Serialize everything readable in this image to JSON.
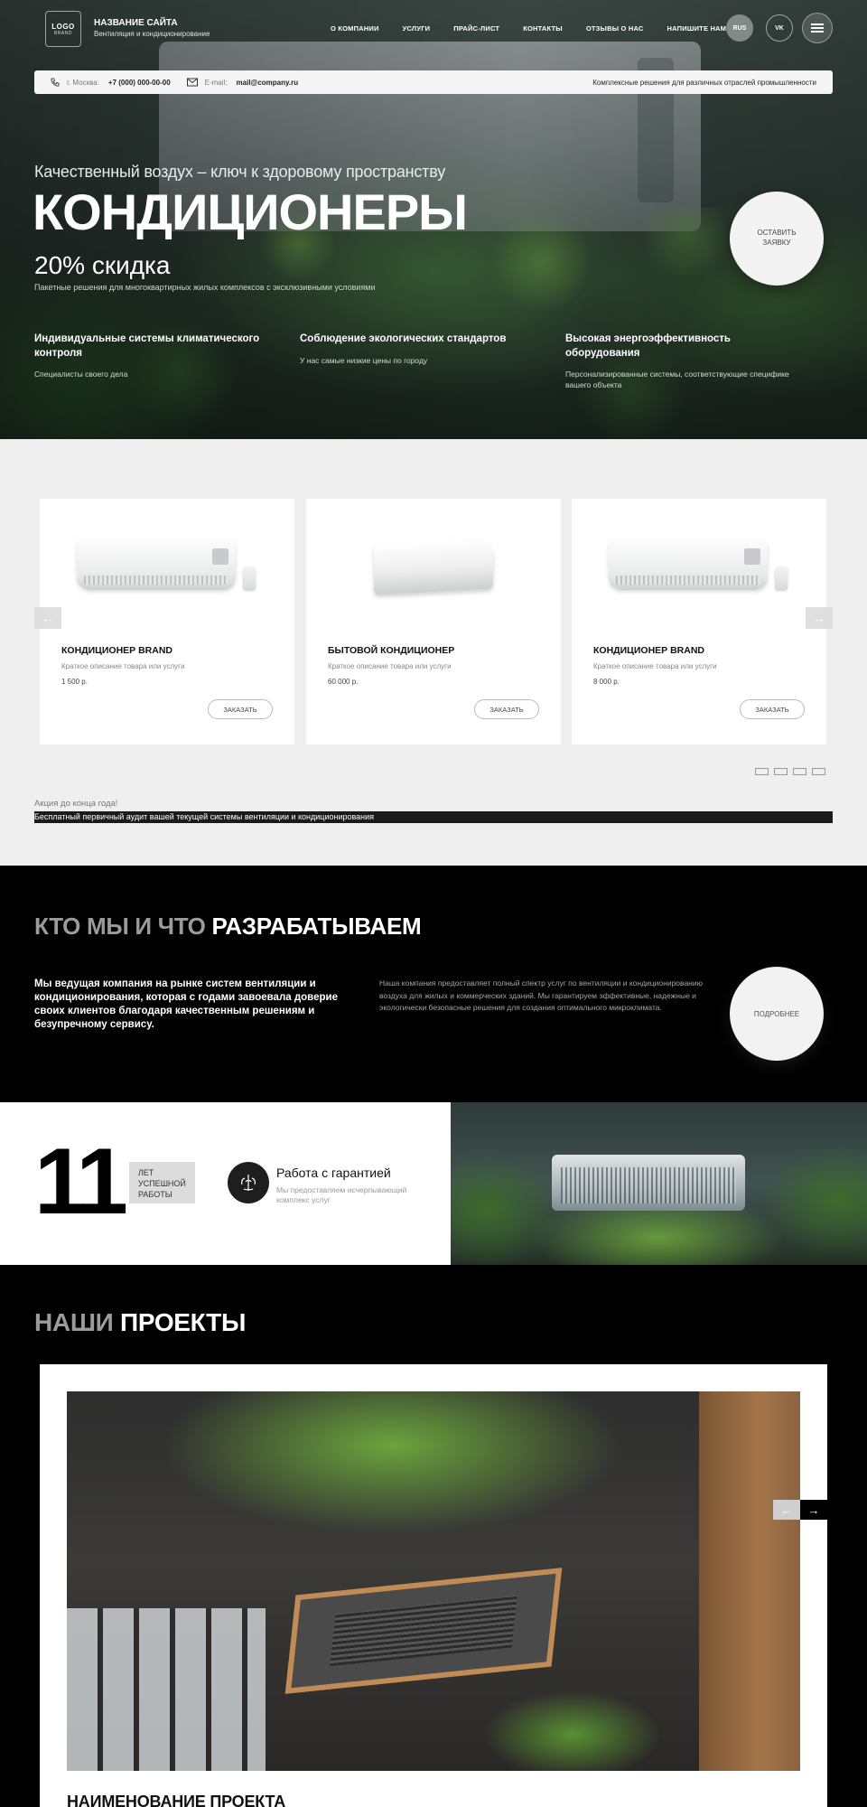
{
  "header": {
    "logo_line1": "LOGO",
    "logo_line2": "BRAND",
    "site_title": "НАЗВАНИЕ САЙТА",
    "site_subtitle": "Вентиляция и кондиционирование",
    "nav": [
      "О КОМПАНИИ",
      "УСЛУГИ",
      "ПРАЙС-ЛИСТ",
      "КОНТАКТЫ",
      "ОТЗЫВЫ О НАС",
      "НАПИШИТЕ НАМ"
    ],
    "lang_label": "RUS",
    "vk_label": "VK",
    "menu_icon": "hamburger-icon"
  },
  "info_bar": {
    "city_label": "г. Москва:",
    "phone": "+7 (000) 000-00-00",
    "email_label": "E-mail:",
    "email": "mail@company.ru",
    "tagline": "Комплексные решения для различных отраслей промышленности"
  },
  "hero": {
    "subtitle": "Качественный воздух – ключ к здоровому пространству",
    "title": "КОНДИЦИОНЕРЫ",
    "discount": "20% скидка",
    "discount_note": "Пакетные решения для многоквартирных жилых комплексов с эксклюзивными условиями",
    "cta_line1": "ОСТАВИТЬ",
    "cta_line2": "ЗАЯВКУ",
    "features": [
      {
        "title": "Индивидуальные системы климатического контроля",
        "text": "Специалисты своего дела"
      },
      {
        "title": "Соблюдение экологических стандартов",
        "text": "У нас самые низкие цены по городу"
      },
      {
        "title": "Высокая энергоэффективность оборудования",
        "text": "Персонализированные системы, соответствующие специфике вашего объекта"
      }
    ]
  },
  "products": {
    "items": [
      {
        "name": "КОНДИЦИОНЕР BRAND",
        "desc": "Краткое описание товара или услуги",
        "price": "1 500 р.",
        "button": "ЗАКАЗАТЬ"
      },
      {
        "name": "БЫТОВОЙ КОНДИЦИОНЕР",
        "desc": "Краткое описание товара или услуги",
        "price": "60 000 р.",
        "button": "ЗАКАЗАТЬ"
      },
      {
        "name": "КОНДИЦИОНЕР BRAND",
        "desc": "Краткое описание товара или услуги",
        "price": "8 000 р.",
        "button": "ЗАКАЗАТЬ"
      }
    ],
    "prev_arrow": "←",
    "next_arrow": "→",
    "promo_title": "Акция до конца года!",
    "promo_text": "Бесплатный первичный аудит вашей текущей системы вентиляции и кондиционирования"
  },
  "about": {
    "title_gray": "КТО МЫ И ЧТО",
    "title_white": "РАЗРАБАТЫВАЕМ",
    "left_text": "Мы ведущая компания на рынке систем вентиляции и кондиционирования, которая с годами завоевала доверие своих клиентов благодаря качественным решениям и безупречному сервису.",
    "right_text": "Наша компания предоставляет полный спектр услуг по вентиляции и кондиционированию воздуха для жилых и коммерческих зданий. Мы гарантируем эффективные, надежные и экологически безопасные решения для создания оптимального микроклимата.",
    "cta": "ПОДРОБНЕЕ"
  },
  "stats": {
    "number": "11",
    "badge_line1": "ЛЕТ",
    "badge_line2": "УСПЕШНОЙ",
    "badge_line3": "РАБОТЫ",
    "guarantee_title": "Работа с гарантией",
    "guarantee_text": "Мы предоставляем исчерпывающий комплекс услуг"
  },
  "projects": {
    "title_gray": "НАШИ",
    "title_white": "ПРОЕКТЫ",
    "prev_arrow": "←",
    "next_arrow": "→",
    "project_name": "НАИМЕНОВАНИЕ ПРОЕКТА"
  }
}
